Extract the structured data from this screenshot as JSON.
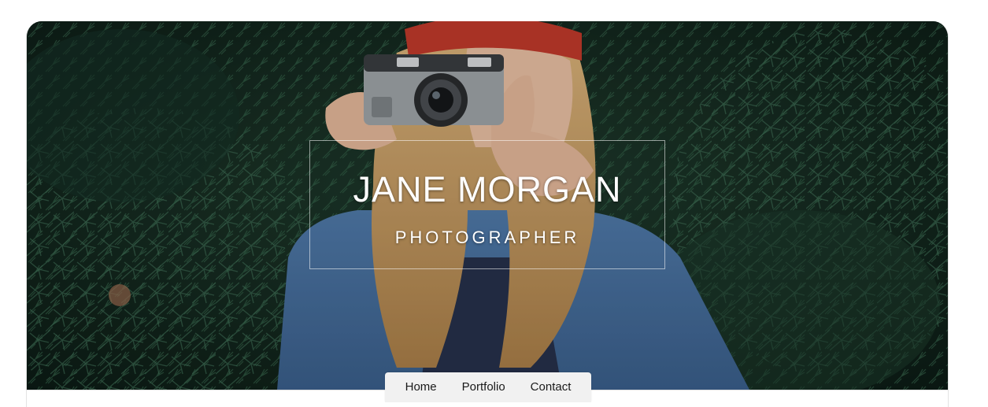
{
  "hero": {
    "title": "JANE MORGAN",
    "subtitle": "PHOTOGRAPHER",
    "image_description_icon": "photo-of-woman-with-camera"
  },
  "nav": {
    "items": [
      {
        "label": "Home"
      },
      {
        "label": "Portfolio"
      },
      {
        "label": "Contact"
      }
    ]
  },
  "colors": {
    "text_on_hero": "#ffffff",
    "nav_background": "#f1f1f1",
    "page_background": "#ffffff"
  }
}
